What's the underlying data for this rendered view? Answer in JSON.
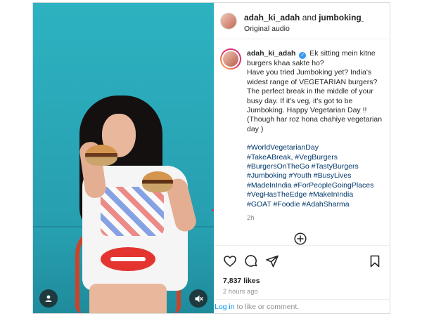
{
  "header": {
    "user1": "adah_ki_adah",
    "and": "and",
    "user2": "jumboking_india",
    "audio": "Original audio"
  },
  "caption": {
    "username": "adah_ki_adah",
    "text": "Ek sitting mein kitne burgers khaa sakte ho?\nHave you tried Jumboking yet? India's widest range of VEGETARIAN burgers? The perfect break in the middle of your busy day. If it's veg, it's got to be Jumboking. Happy Vegetarian Day !! (Though har roz hona chahiye vegetarian day )",
    "hashtags": "#WorldVegetarianDay\n#TakeABreak, #VegBurgers\n#BurgersOnTheGo #TastyBurgers\n#Jumboking #Youth #BusyLives\n#MadeInIndia #ForPeopleGoingPlaces\n#VegHasTheEdge #MakeInIndia\n#GOAT #Foodie #AdahSharma",
    "time": "2h"
  },
  "stats": {
    "likes": "7,837 likes",
    "posted": "2 hours ago"
  },
  "footer": {
    "login": "Log in",
    "rest": " to like or comment."
  },
  "icons": {
    "verified": "verified-badge-icon",
    "user": "user-tag-icon",
    "mute": "audio-muted-icon",
    "add": "plus-circle-icon",
    "like": "heart-icon",
    "comment": "comment-icon",
    "share": "share-icon",
    "save": "bookmark-icon"
  },
  "colors": {
    "link": "#0095f6",
    "hashtag": "#00376b",
    "verified": "#3897f0"
  }
}
